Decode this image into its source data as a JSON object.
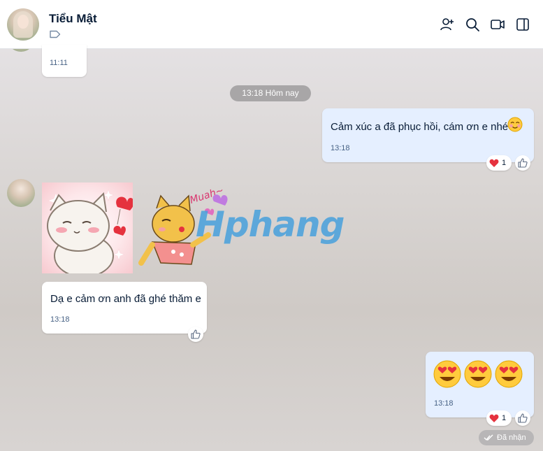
{
  "header": {
    "contact_name": "Tiểu Mật",
    "icons": [
      "add-member-icon",
      "search-icon",
      "video-call-icon",
      "sidebar-toggle-icon"
    ]
  },
  "messages": [
    {
      "sender": "contact",
      "time": "11:11"
    },
    {
      "sender": "me",
      "text": "Cảm xúc a đã phục hồi, cám ơn e nhé",
      "emoji": "flushed-smile",
      "time": "13:18",
      "reaction": "heart",
      "reaction_count": "1"
    },
    {
      "sender": "contact",
      "type": "stickers"
    },
    {
      "sender": "contact",
      "text": "Dạ e cảm ơn anh đã ghé thăm e",
      "time": "13:18"
    },
    {
      "sender": "me",
      "emoji": "heart-eyes x3",
      "time": "13:18",
      "reaction": "heart",
      "reaction_count": "1"
    }
  ],
  "date_separator": "13:18 Hôm nay",
  "sticker_text": "Muah~",
  "watermark": "Hphang",
  "status": "Đã nhận",
  "colors": {
    "my_bubble": "#e5efff",
    "their_bubble": "#ffffff",
    "heart": "#e5323e",
    "accent": "#0068ff"
  }
}
